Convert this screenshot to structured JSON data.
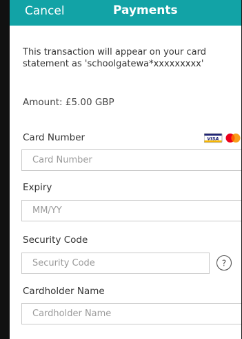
{
  "header": {
    "cancel_label": "Cancel",
    "title": "Payments",
    "background_color": "#12a3a6"
  },
  "notice": "This transaction will appear on your card statement as 'schoolgatewa*xxxxxxxxx'",
  "amount": "Amount: £5.00 GBP",
  "form": {
    "card_number": {
      "label": "Card Number",
      "placeholder": "Card Number",
      "card_icons": [
        "visa-icon",
        "mastercard-icon"
      ],
      "visa_text": "VISA"
    },
    "expiry": {
      "label": "Expiry",
      "placeholder": "MM/YY"
    },
    "security_code": {
      "label": "Security Code",
      "placeholder": "Security Code",
      "help_icon": "question-circle-icon",
      "help_text": "?"
    },
    "cardholder_name": {
      "label": "Cardholder Name",
      "placeholder": "Cardholder Name"
    }
  }
}
